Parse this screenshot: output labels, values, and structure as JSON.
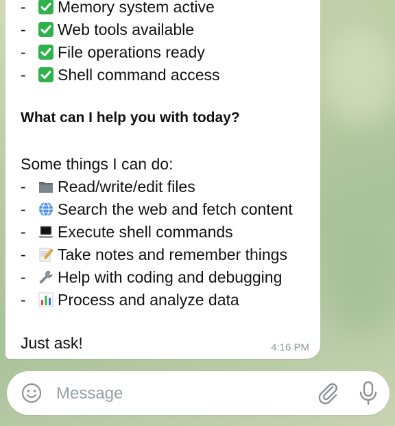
{
  "message": {
    "status_lines": [
      {
        "dash": "-",
        "icon": "check-mark-button-icon",
        "text": "Memory system active"
      },
      {
        "dash": "-",
        "icon": "check-mark-button-icon",
        "text": "Web tools available"
      },
      {
        "dash": "-",
        "icon": "check-mark-button-icon",
        "text": "File operations ready"
      },
      {
        "dash": "-",
        "icon": "check-mark-button-icon",
        "text": "Shell command access"
      }
    ],
    "question": "What can I help you with today?",
    "intro": "Some things I can do:",
    "capabilities": [
      {
        "dash": "-",
        "icon": "folder-icon",
        "text": "Read/write/edit files"
      },
      {
        "dash": "-",
        "icon": "globe-icon",
        "text": "Search the web and fetch content"
      },
      {
        "dash": "-",
        "icon": "laptop-icon",
        "text": "Execute shell commands"
      },
      {
        "dash": "-",
        "icon": "memo-icon",
        "text": "Take notes and remember things"
      },
      {
        "dash": "-",
        "icon": "wrench-icon",
        "text": "Help with coding and debugging"
      },
      {
        "dash": "-",
        "icon": "bar-chart-icon",
        "text": "Process and analyze data"
      }
    ],
    "closing": "Just ask!",
    "time": "4:16 PM"
  },
  "composer": {
    "placeholder": "Message"
  },
  "colors": {
    "check_green": "#2fb24c",
    "icon_gray": "#8a9298",
    "time_gray": "#8e9a93"
  }
}
